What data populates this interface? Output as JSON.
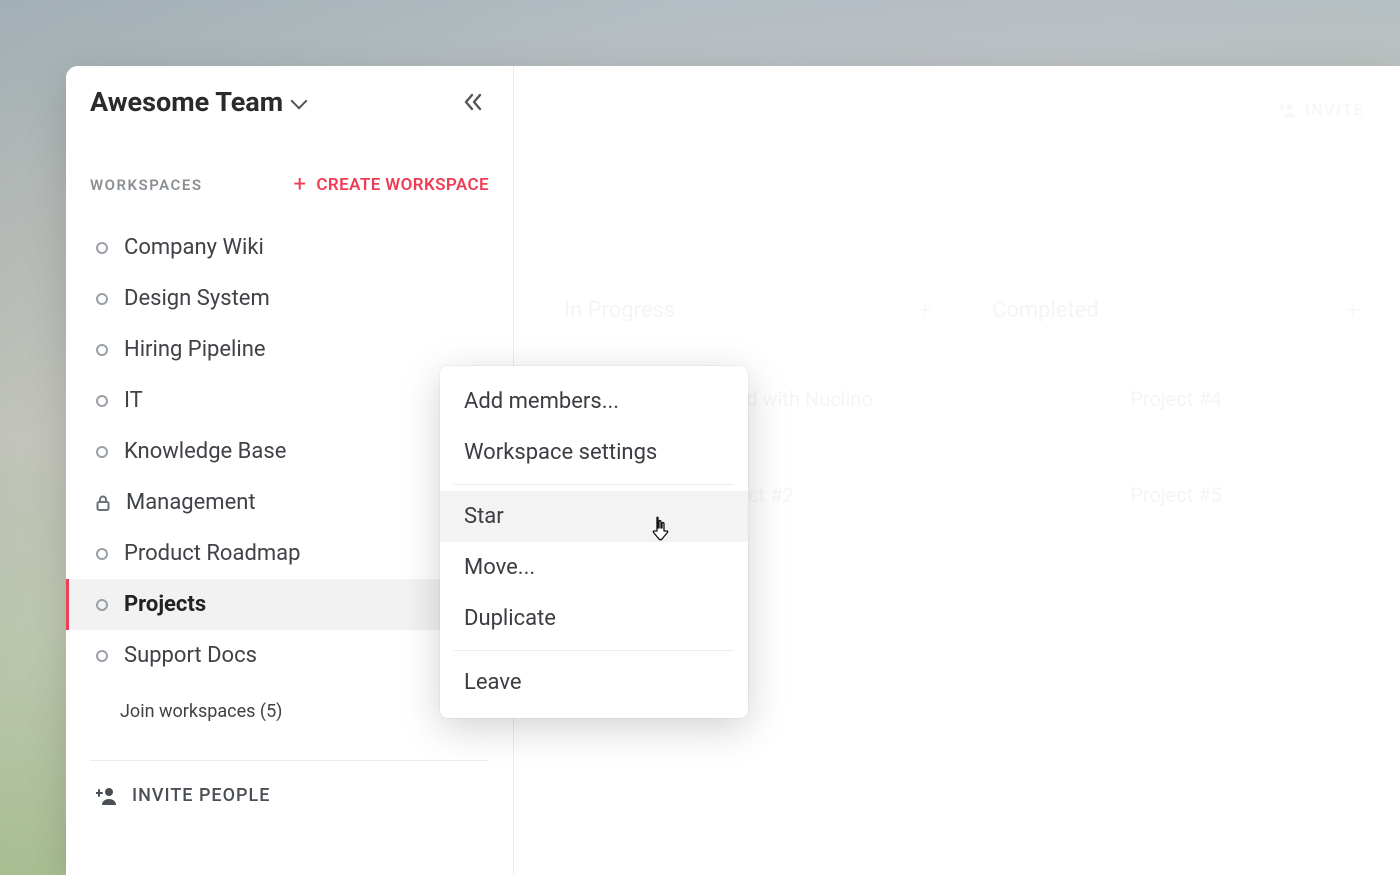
{
  "team": {
    "name": "Awesome Team"
  },
  "sidebar": {
    "workspaces_label": "WORKSPACES",
    "create_workspace_label": "CREATE WORKSPACE",
    "items": [
      {
        "label": "Company Wiki",
        "icon": "circle"
      },
      {
        "label": "Design System",
        "icon": "circle"
      },
      {
        "label": "Hiring Pipeline",
        "icon": "circle"
      },
      {
        "label": "IT",
        "icon": "circle"
      },
      {
        "label": "Knowledge Base",
        "icon": "circle"
      },
      {
        "label": "Management",
        "icon": "lock"
      },
      {
        "label": "Product Roadmap",
        "icon": "circle"
      },
      {
        "label": "Projects",
        "icon": "circle",
        "active": true
      },
      {
        "label": "Support Docs",
        "icon": "circle"
      }
    ],
    "join_workspaces_label": "Join workspaces (5)",
    "invite_people_label": "INVITE PEOPLE"
  },
  "context_menu": {
    "items": [
      {
        "label": "Add members..."
      },
      {
        "label": "Workspace settings"
      },
      {
        "sep": true
      },
      {
        "label": "Star",
        "hover": true
      },
      {
        "label": "Move..."
      },
      {
        "label": "Duplicate"
      },
      {
        "sep": true
      },
      {
        "label": "Leave"
      }
    ]
  },
  "main": {
    "invite_label": "INVITE",
    "columns": [
      {
        "header": "In Progress",
        "cards": [
          "Getting Started with Nuclino",
          "Project #2"
        ]
      },
      {
        "header": "Completed",
        "cards": [
          "Project #4",
          "Project #5"
        ]
      }
    ]
  },
  "colors": {
    "accent": "#ef3d55"
  }
}
